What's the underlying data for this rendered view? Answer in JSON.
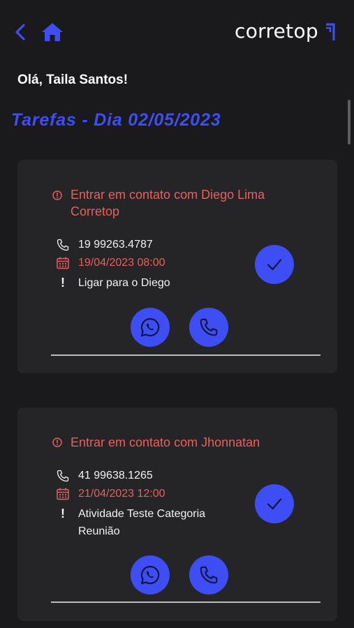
{
  "header": {
    "back_icon": "chevron-left-icon",
    "home_icon": "home-icon",
    "brand": "corretop",
    "brand_mark_icon": "corretop-arrow-mark",
    "accent_color": "#3d4ef5"
  },
  "greeting": "Olá, Taila Santos!",
  "page_title": "Tarefas - Dia 02/05/2023",
  "tasks": [
    {
      "title": "Entrar em contato com Diego Lima Corretop",
      "phone": "19 99263.4787",
      "datetime": "19/04/2023 08:00",
      "note": "Ligar para o Diego"
    },
    {
      "title": "Entrar em contato com Jhonnatan",
      "phone": "41 99638.1265",
      "datetime": "21/04/2023 12:00",
      "note": "Atividade Teste Categoria Reunião"
    }
  ],
  "colors": {
    "background": "#1a1a1c",
    "card": "#252527",
    "alert": "#e8605a",
    "accent": "#3d4ef5"
  }
}
